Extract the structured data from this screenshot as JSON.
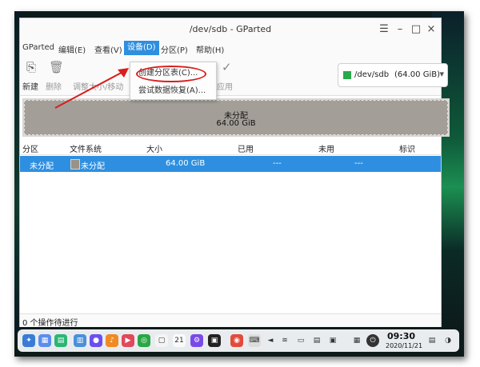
{
  "window": {
    "title": "/dev/sdb - GParted"
  },
  "menubar": {
    "items": [
      {
        "label": "GParted"
      },
      {
        "label": "编辑(E)"
      },
      {
        "label": "查看(V)"
      },
      {
        "label": "设备(D)",
        "active": true
      },
      {
        "label": "分区(P)"
      },
      {
        "label": "帮助(H)"
      }
    ]
  },
  "dropdown": {
    "items": [
      {
        "label": "创建分区表(C)..."
      },
      {
        "label": "尝试数据恢复(A)..."
      }
    ]
  },
  "toolbar": {
    "new_label": "新建",
    "delete_label": "删除",
    "resize_label": "调整大小/移动",
    "apply_label": "应用"
  },
  "device_selector": {
    "device": "/dev/sdb",
    "size": "(64.00 GiB)",
    "accent_color": "#2aa84a"
  },
  "graph": {
    "label": "未分配",
    "size": "64.00 GiB"
  },
  "table": {
    "headers": [
      "分区",
      "文件系统",
      "大小",
      "已用",
      "未用",
      "标识"
    ],
    "rows": [
      {
        "partition": "未分配",
        "filesystem": "未分配",
        "size": "64.00 GiB",
        "used": "---",
        "unused": "---",
        "flags": ""
      }
    ]
  },
  "status": {
    "text": "0 个操作待进行"
  },
  "taskbar": {
    "time": "09:30",
    "date": "2020/11/21"
  },
  "colors": {
    "selection": "#2e8fe0",
    "annotation_red": "#d81e1e"
  }
}
